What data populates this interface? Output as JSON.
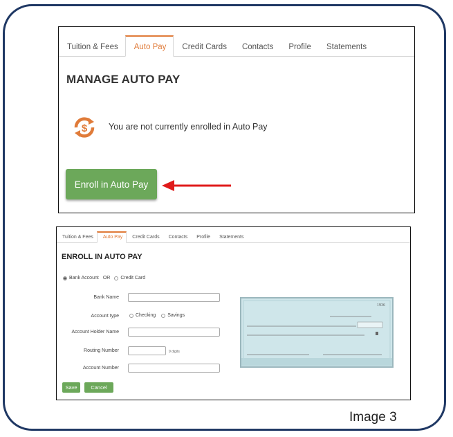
{
  "screen1": {
    "tabs": [
      "Tuition & Fees",
      "Auto Pay",
      "Credit Cards",
      "Contacts",
      "Profile",
      "Statements"
    ],
    "active_tab": "Auto Pay",
    "title": "MANAGE AUTO PAY",
    "message": "You are not currently enrolled in Auto Pay",
    "enroll_button": "Enroll in Auto Pay"
  },
  "screen2": {
    "tabs": [
      "Tuition & Fees",
      "Auto Pay",
      "Credit Cards",
      "Contacts",
      "Profile",
      "Statements"
    ],
    "active_tab": "Auto Pay",
    "title": "ENROLL IN AUTO PAY",
    "payment_options": {
      "bank": "Bank Account",
      "or": "OR",
      "card": "Credit Card",
      "selected": "Bank Account"
    },
    "fields": {
      "bank_name": "Bank Name",
      "account_type": "Account type",
      "checking": "Checking",
      "savings": "Savings",
      "holder": "Account Holder Name",
      "routing": "Routing Number",
      "routing_hint": "9 digits",
      "account_number": "Account Number"
    },
    "check_number": "1936",
    "save_button": "Save",
    "cancel_button": "Cancel"
  },
  "caption": "Image 3",
  "colors": {
    "frame": "#1f3864",
    "accent": "#e07b39",
    "button": "#6ca85a",
    "arrow": "#e01b1b",
    "check": "#cfe6ea"
  }
}
